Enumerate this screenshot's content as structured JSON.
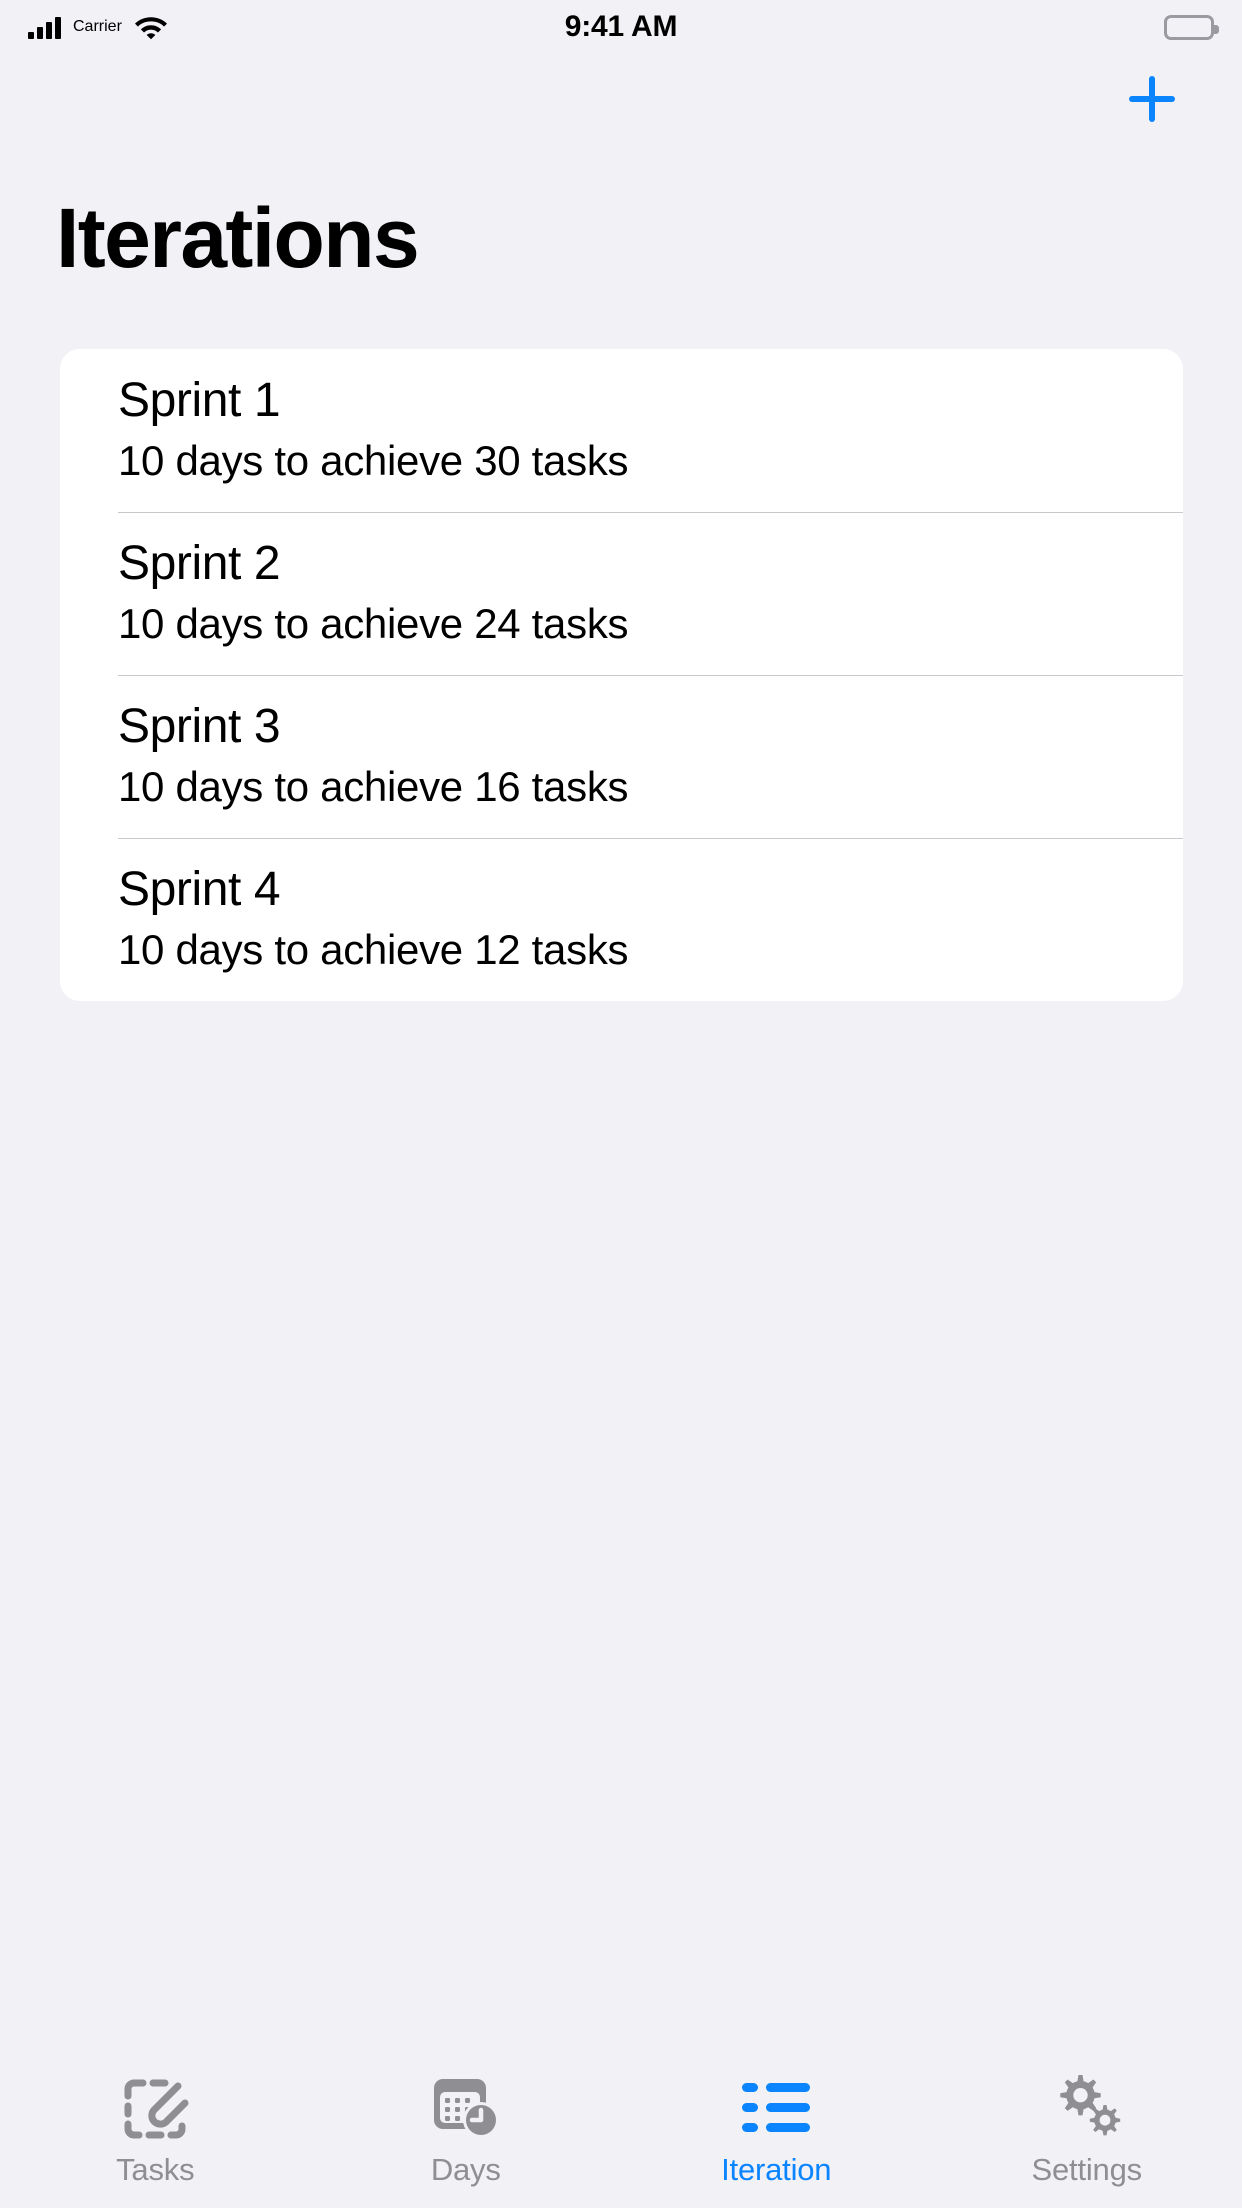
{
  "status_bar": {
    "carrier": "Carrier",
    "time": "9:41 AM",
    "signal_icon": "signal-bars-icon",
    "wifi_icon": "wifi-icon",
    "battery_icon": "battery-full-icon",
    "battery_level": "100"
  },
  "nav": {
    "add_label": "+",
    "add_icon": "plus-icon",
    "accent_color": "#0a84ff"
  },
  "header": {
    "title": "Iterations"
  },
  "list": {
    "rows": [
      {
        "title": "Sprint 1",
        "subtitle": "10 days to achieve 30 tasks"
      },
      {
        "title": "Sprint 2",
        "subtitle": "10 days to achieve 24 tasks"
      },
      {
        "title": "Sprint 3",
        "subtitle": "10 days to achieve 16 tasks"
      },
      {
        "title": "Sprint 4",
        "subtitle": "10 days to achieve 12 tasks"
      }
    ]
  },
  "tab_bar": {
    "active_index": 2,
    "active_color": "#0a84ff",
    "inactive_color": "#8e8e93",
    "items": [
      {
        "label": "Tasks",
        "icon": "paperclip-document-icon"
      },
      {
        "label": "Days",
        "icon": "calendar-clock-icon"
      },
      {
        "label": "Iteration",
        "icon": "bulleted-list-icon"
      },
      {
        "label": "Settings",
        "icon": "gears-icon"
      }
    ]
  }
}
